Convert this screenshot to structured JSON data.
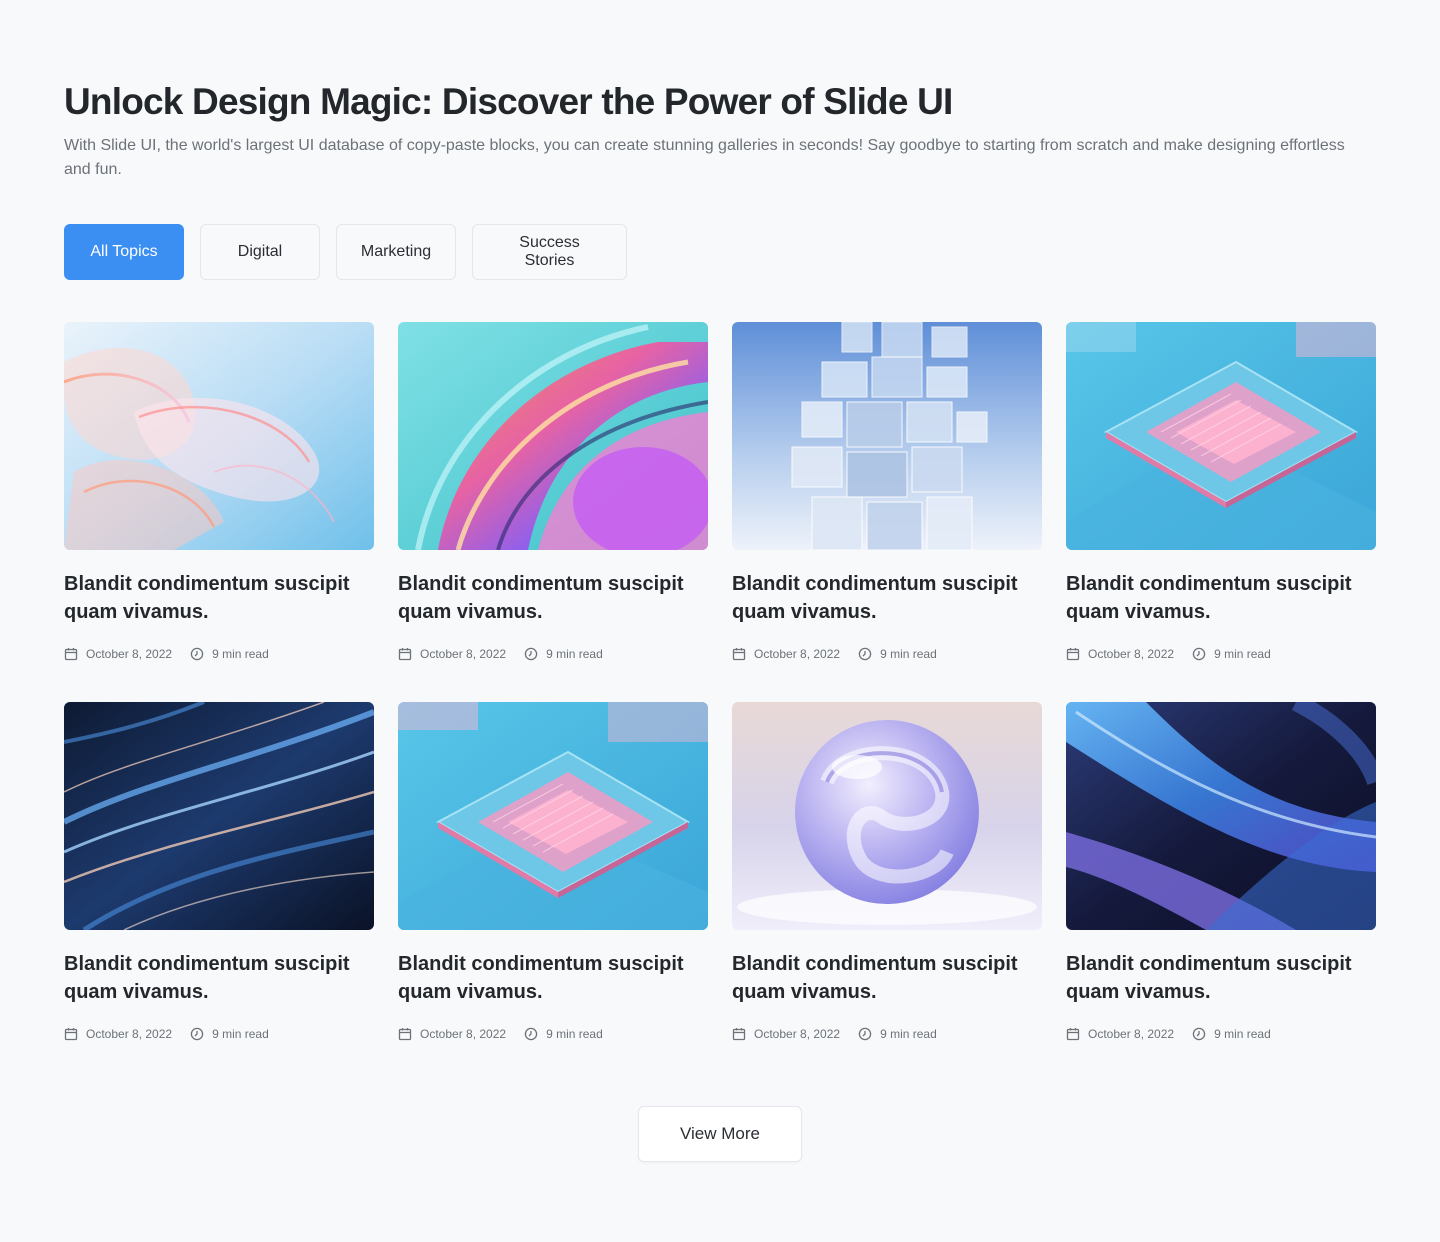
{
  "header": {
    "title": "Unlock Design Magic: Discover the Power of Slide UI",
    "subtitle": "With Slide UI, the world's largest UI database of copy-paste blocks, you can create stunning galleries in seconds! Say goodbye to starting from scratch and make designing effortless and fun."
  },
  "tabs": [
    {
      "label": "All Topics",
      "active": true
    },
    {
      "label": "Digital",
      "active": false
    },
    {
      "label": "Marketing",
      "active": false
    },
    {
      "label": "Success Stories",
      "active": false
    }
  ],
  "accent_color": "#3b8ff3",
  "cards": [
    {
      "title": "Blandit condimentum suscipit quam vivamus.",
      "date": "October 8, 2022",
      "read_time": "9 min read",
      "image": "glass-ribbons-image"
    },
    {
      "title": "Blandit condimentum suscipit quam vivamus.",
      "date": "October 8, 2022",
      "read_time": "9 min read",
      "image": "iridescent-swirl-image"
    },
    {
      "title": "Blandit condimentum suscipit quam vivamus.",
      "date": "October 8, 2022",
      "read_time": "9 min read",
      "image": "glass-cubes-tower-image"
    },
    {
      "title": "Blandit condimentum suscipit quam vivamus.",
      "date": "October 8, 2022",
      "read_time": "9 min read",
      "image": "circuit-chip-image"
    },
    {
      "title": "Blandit condimentum suscipit quam vivamus.",
      "date": "October 8, 2022",
      "read_time": "9 min read",
      "image": "dark-light-streaks-image"
    },
    {
      "title": "Blandit condimentum suscipit quam vivamus.",
      "date": "October 8, 2022",
      "read_time": "9 min read",
      "image": "circuit-chip-image"
    },
    {
      "title": "Blandit condimentum suscipit quam vivamus.",
      "date": "October 8, 2022",
      "read_time": "9 min read",
      "image": "glass-sphere-image"
    },
    {
      "title": "Blandit condimentum suscipit quam vivamus.",
      "date": "October 8, 2022",
      "read_time": "9 min read",
      "image": "blue-waves-image"
    }
  ],
  "view_more_label": "View More"
}
